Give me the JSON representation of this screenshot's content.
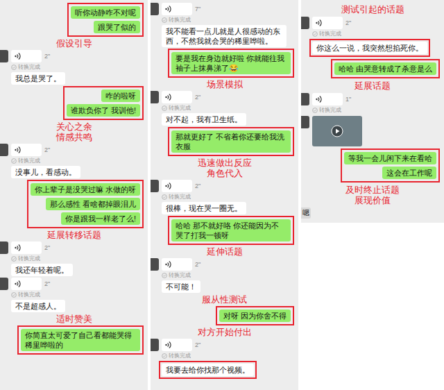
{
  "columns": [
    {
      "items": [
        {
          "kind": "outgoing",
          "boxed": true,
          "bubbles": [
            "听你动静咋不对呢",
            "跟哭了似的"
          ]
        },
        {
          "kind": "note",
          "lines": [
            "假设引导"
          ]
        },
        {
          "kind": "incoming",
          "boxed": false,
          "duration": "2\"",
          "status": "转换完成",
          "text": "我总是哭了。"
        },
        {
          "kind": "outgoing",
          "boxed": true,
          "bubbles": [
            "咋的啦呀",
            "谁欺负你了 我训他!"
          ]
        },
        {
          "kind": "note",
          "lines": [
            "关心之余",
            "情感共鸣"
          ]
        },
        {
          "kind": "incoming",
          "boxed": false,
          "duration": "2\"",
          "status": "转换完成",
          "text": "没事儿，看感动。"
        },
        {
          "kind": "outgoing",
          "boxed": true,
          "bubbles": [
            "你上辈子是没哭过嘛 水做的呀",
            "那么感性 看啥都掉眼泪儿",
            "你是跟我一样老了么!"
          ]
        },
        {
          "kind": "note",
          "lines": [
            "延展转移话题"
          ]
        },
        {
          "kind": "incoming",
          "boxed": false,
          "duration": "2\"",
          "status": "转换完成",
          "text": "我还年轻着呢。"
        },
        {
          "kind": "incoming",
          "boxed": false,
          "duration": "2\"",
          "status": "转换完成",
          "text": "不是超感人。"
        },
        {
          "kind": "note",
          "lines": [
            "适时赞美"
          ]
        },
        {
          "kind": "outgoing",
          "boxed": true,
          "bubbles": [
            "你简直太可爱了自己看都能哭得稀里哗啦的"
          ]
        }
      ]
    },
    {
      "items": [
        {
          "kind": "incoming",
          "boxed": false,
          "duration": "7\"",
          "status": "转换完成",
          "text": "我不能看一点儿就是人很感动的东西，不然我就会哭的稀里哗啦。"
        },
        {
          "kind": "outgoing",
          "boxed": true,
          "bubbles": [
            "要是我在身边就好啦 你就能往我袖子上抹鼻涕了😂"
          ]
        },
        {
          "kind": "note",
          "lines": [
            "场景模拟"
          ]
        },
        {
          "kind": "incoming",
          "boxed": false,
          "duration": "2\"",
          "status": "转换完成",
          "text": "对不起，我有卫生纸。"
        },
        {
          "kind": "outgoing",
          "boxed": true,
          "bubbles": [
            "那就更好了 不省着你还要给我洗衣服"
          ]
        },
        {
          "kind": "note",
          "lines": [
            "迅速做出反应",
            "角色代入"
          ]
        },
        {
          "kind": "incoming",
          "boxed": false,
          "duration": "2\"",
          "status": "转换完成",
          "text": "很棒，现在哭一圈无。"
        },
        {
          "kind": "outgoing",
          "boxed": true,
          "bubbles": [
            "哈哈 那不就好咯 你还能因为不哭了打我一顿呀"
          ]
        },
        {
          "kind": "note",
          "lines": [
            "延伸话题"
          ]
        },
        {
          "kind": "incoming",
          "boxed": false,
          "duration": "2\"",
          "status": "转换完成",
          "text": "不可能！"
        },
        {
          "kind": "note",
          "lines": [
            "服从性测试"
          ]
        },
        {
          "kind": "outgoing",
          "boxed": true,
          "bubbles": [
            "对呀 因为你舍不得"
          ]
        },
        {
          "kind": "note",
          "lines": [
            "对方开始付出"
          ]
        },
        {
          "kind": "incoming",
          "boxed": true,
          "duration": "2\"",
          "status": "转换完成",
          "text": "我要去给你找那个视频。"
        }
      ]
    },
    {
      "items": [
        {
          "kind": "note",
          "lines": [
            "测试引起的话题"
          ]
        },
        {
          "kind": "incoming",
          "boxed": true,
          "duration": "2\"",
          "status": "转换完成",
          "text": "你这么一说，我突然想掐死你。"
        },
        {
          "kind": "outgoing",
          "boxed": true,
          "bubbles": [
            "哈哈 由哭意转成了杀意是么"
          ]
        },
        {
          "kind": "note",
          "lines": [
            "延展话题"
          ]
        },
        {
          "kind": "incoming",
          "boxed": false,
          "duration": "1\"",
          "status": "转换完成"
        },
        {
          "kind": "video"
        },
        {
          "kind": "outgoing",
          "boxed": true,
          "bubbles": [
            "等我一会儿闲下来在看哈",
            "这会在工作呢"
          ]
        },
        {
          "kind": "note",
          "lines": [
            "及时终止话题",
            "展现价值"
          ]
        },
        {
          "kind": "cut",
          "text": "嗯"
        }
      ]
    }
  ]
}
